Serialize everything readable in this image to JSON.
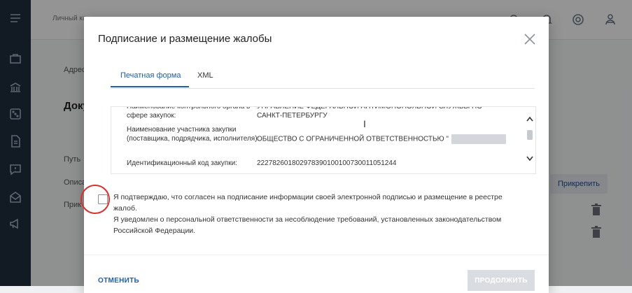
{
  "background": {
    "breadcrumb": "Личный ка",
    "labels": {
      "address": "Адрес",
      "documents": "Доку",
      "path": "Путь",
      "description": "Описа",
      "attached": "Прик"
    },
    "attach_button": "Прикрепить"
  },
  "modal": {
    "title": "Подписание и размещение жалобы",
    "tabs": [
      {
        "label": "Печатная форма",
        "active": true
      },
      {
        "label": "XML",
        "active": false
      }
    ],
    "rows": [
      {
        "key": "Наименование контрольного органа в сфере закупок:",
        "value": "УПРАВЛЕНИЕ ФЕДЕРАЛЬНОЙ АНТИМОНОПОЛЬНОЙ СЛУЖБЫ ПО САНКТ-ПЕТЕРБУРГУ"
      },
      {
        "key": "Наименование участника закупки (поставщика, подрядчика, исполнителя):",
        "value": "ОБЩЕСТВО С ОГРАНИЧЕННОЙ ОТВЕТСТВЕННОСТЬЮ \""
      },
      {
        "key": "Идентификационный код закупки:",
        "value": "222782601802978390100100730011051244"
      }
    ],
    "consent_text_1": "Я подтверждаю, что согласен на подписание информации своей электронной подписью и размещение в реестре жалоб.",
    "consent_text_2": "Я уведомлен о персональной ответственности за несоблюдение требований, установленных законодательством Российской Федерации.",
    "consent_checked": false,
    "cancel_label": "ОТМЕНИТЬ",
    "continue_label": "ПРОДОЛЖИТЬ"
  },
  "colors": {
    "accent": "#1d5fa8",
    "rail": "#1f2d3d",
    "highlight_circle": "#d8322c"
  }
}
